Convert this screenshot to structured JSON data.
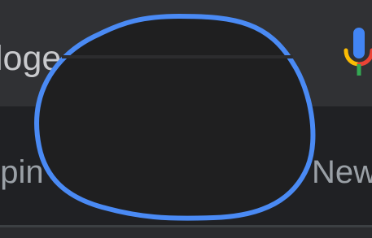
{
  "search": {
    "query_fragment": "loge"
  },
  "tabs": {
    "left_partial": "ppin",
    "right_partial": "New"
  },
  "icons": {
    "mic": "microphone-icon"
  },
  "colors": {
    "search_bar_bg": "#303134",
    "page_bg": "#202124",
    "focus_outline": "#4a8af4",
    "blob_fill": "#1f1f20",
    "text_primary": "#c9cacd",
    "text_secondary": "#9aa0a6",
    "mic_blue": "#4285f4",
    "mic_red": "#ea4335",
    "mic_yellow": "#fbbc04",
    "mic_green": "#34a853"
  }
}
